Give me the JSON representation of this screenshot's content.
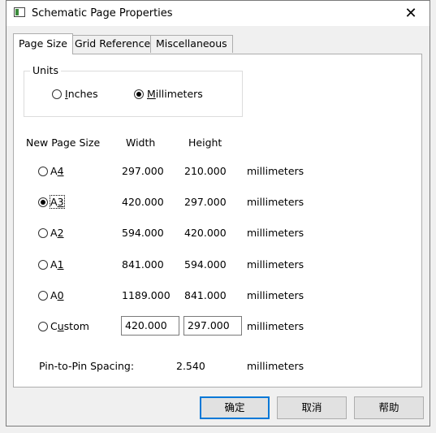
{
  "window": {
    "title": "Schematic Page Properties",
    "close_label": "✕"
  },
  "tabs": [
    {
      "label": "Page Size",
      "active": true
    },
    {
      "label": "Grid Reference",
      "active": false
    },
    {
      "label": "Miscellaneous",
      "active": false
    }
  ],
  "units": {
    "legend": "Units",
    "options": [
      {
        "pre": "",
        "ul": "I",
        "post": "nches",
        "selected": false
      },
      {
        "pre": "",
        "ul": "M",
        "post": "illimeters",
        "selected": true
      }
    ]
  },
  "sizes": {
    "headers": {
      "new_page_size": "New Page Size",
      "width": "Width",
      "height": "Height"
    },
    "rows": [
      {
        "pre": "A",
        "ul": "4",
        "post": "",
        "width": "297.000",
        "height": "210.000",
        "unit": "millimeters",
        "selected": false
      },
      {
        "pre": "A",
        "ul": "3",
        "post": "",
        "width": "420.000",
        "height": "297.000",
        "unit": "millimeters",
        "selected": true
      },
      {
        "pre": "A",
        "ul": "2",
        "post": "",
        "width": "594.000",
        "height": "420.000",
        "unit": "millimeters",
        "selected": false
      },
      {
        "pre": "A",
        "ul": "1",
        "post": "",
        "width": "841.000",
        "height": "594.000",
        "unit": "millimeters",
        "selected": false
      },
      {
        "pre": "A",
        "ul": "0",
        "post": "",
        "width": "1189.000",
        "height": "841.000",
        "unit": "millimeters",
        "selected": false
      }
    ],
    "custom": {
      "pre": "C",
      "ul": "u",
      "post": "stom",
      "width": "420.000",
      "height": "297.000",
      "unit": "millimeters",
      "selected": false
    }
  },
  "pin_spacing": {
    "label": "Pin-to-Pin Spacing:",
    "value": "2.540",
    "unit": "millimeters"
  },
  "buttons": {
    "ok": "确定",
    "cancel": "取消",
    "help": "帮助"
  }
}
